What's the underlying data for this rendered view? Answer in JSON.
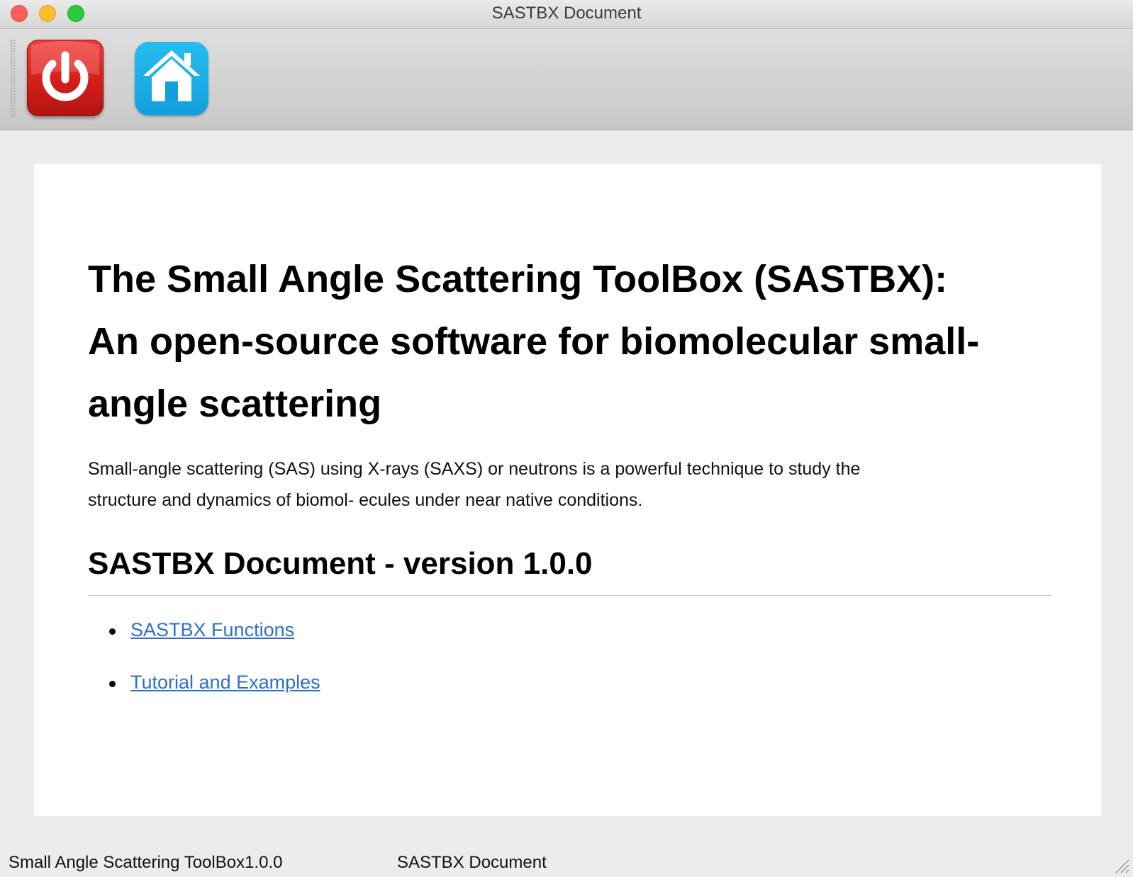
{
  "window": {
    "title": "SASTBX Document"
  },
  "toolbar": {
    "buttons": [
      {
        "name": "power",
        "icon": "power-icon",
        "color": "#d81f1b"
      },
      {
        "name": "home",
        "icon": "home-icon",
        "color": "#12a0dc"
      }
    ]
  },
  "document": {
    "heading_line1": "The Small Angle Scattering ToolBox (SASTBX):",
    "heading_line2": "An open-source software for biomolecular small-",
    "heading_line3": "angle scattering",
    "intro_line1": "Small-angle scattering (SAS) using X-rays (SAXS) or neutrons is a powerful technique to study the",
    "intro_line2": "structure and dynamics of biomol- ecules under near native conditions.",
    "version_title": "SASTBX Document - version 1.0.0",
    "links": [
      {
        "label": "SASTBX Functions"
      },
      {
        "label": "Tutorial and Examples"
      }
    ],
    "link_color": "#2f6fc9"
  },
  "statusbar": {
    "left": "Small Angle Scattering ToolBox1.0.0",
    "right": "SASTBX Document"
  }
}
